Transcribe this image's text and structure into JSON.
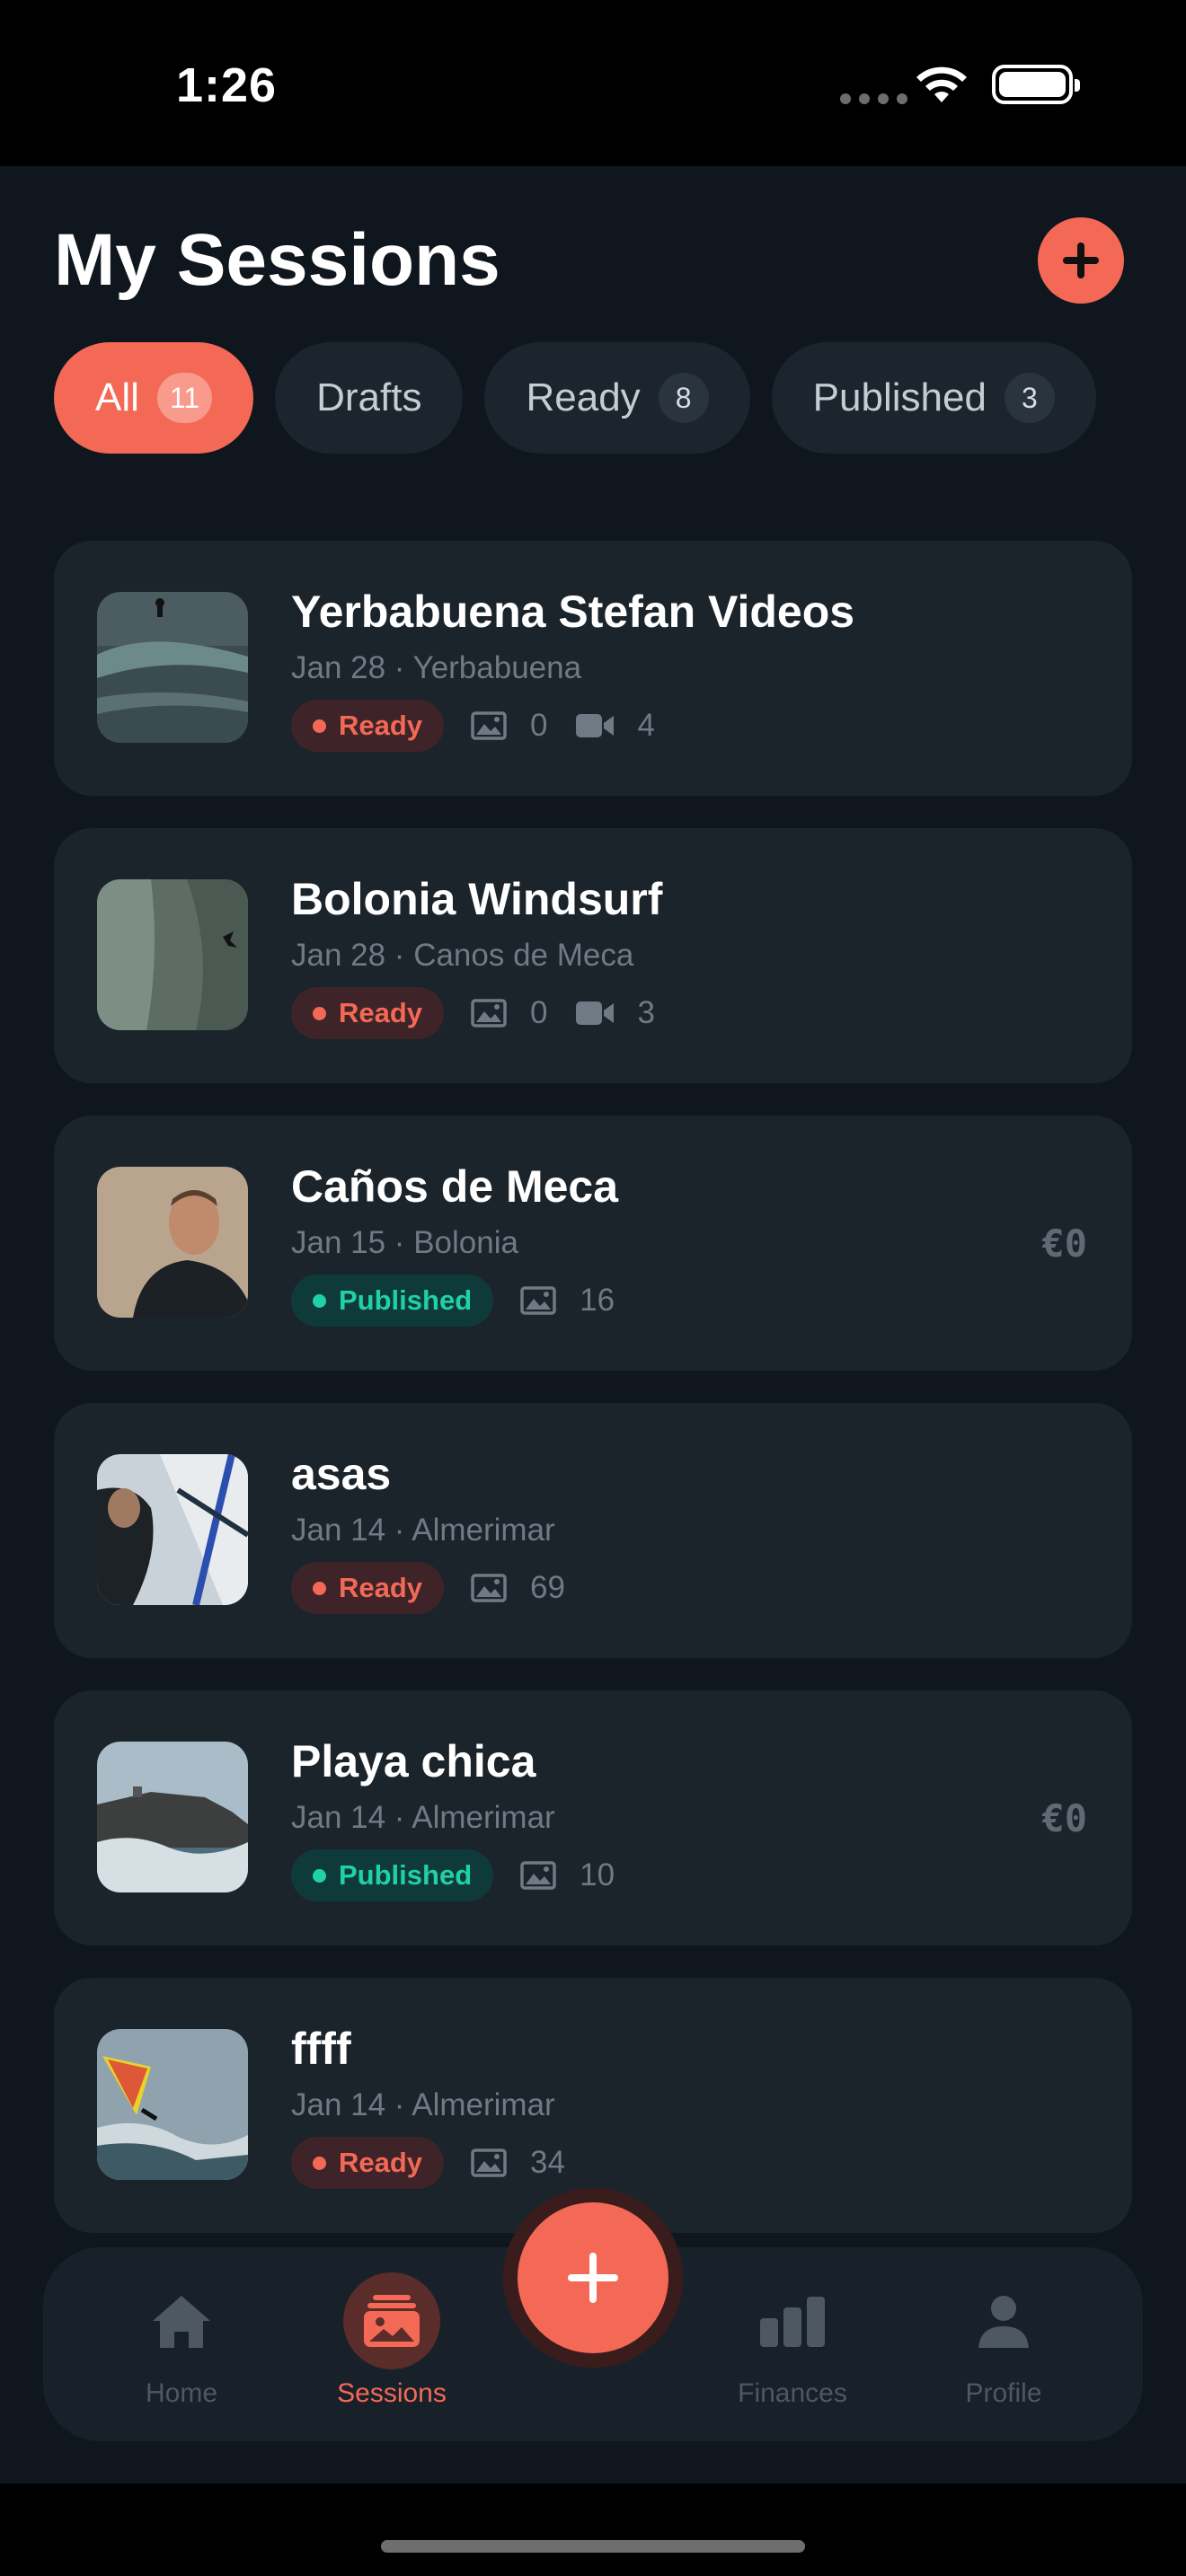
{
  "status": {
    "time": "1:26"
  },
  "header": {
    "title": "My Sessions"
  },
  "filters": [
    {
      "label": "All",
      "count": "11",
      "active": true
    },
    {
      "label": "Drafts",
      "count": ""
    },
    {
      "label": "Ready",
      "count": "8"
    },
    {
      "label": "Published",
      "count": "3"
    }
  ],
  "sessions": [
    {
      "title": "Yerbabuena Stefan Videos",
      "meta": "Jan 28 · Yerbabuena",
      "status": "Ready",
      "photos": "0",
      "videos": "4",
      "price": "",
      "thumb_icon": "surf-wave-photo"
    },
    {
      "title": "Bolonia Windsurf",
      "meta": "Jan 28 · Canos de Meca",
      "status": "Ready",
      "photos": "0",
      "videos": "3",
      "price": "",
      "thumb_icon": "water-photo"
    },
    {
      "title": "Caños de Meca",
      "meta": "Jan 15 · Bolonia",
      "status": "Published",
      "photos": "16",
      "videos": "",
      "price": "€0",
      "thumb_icon": "portrait-photo"
    },
    {
      "title": "asas",
      "meta": "Jan 14 · Almerimar",
      "status": "Ready",
      "photos": "69",
      "videos": "",
      "price": "",
      "thumb_icon": "windsurfer-photo"
    },
    {
      "title": "Playa chica",
      "meta": "Jan 14 · Almerimar",
      "status": "Published",
      "photos": "10",
      "videos": "",
      "price": "€0",
      "thumb_icon": "rock-sea-photo"
    },
    {
      "title": "ffff",
      "meta": "Jan 14 · Almerimar",
      "status": "Ready",
      "photos": "34",
      "videos": "",
      "price": "",
      "thumb_icon": "windsurf-jump-photo"
    }
  ],
  "tabbar": {
    "home": "Home",
    "sessions": "Sessions",
    "finances": "Finances",
    "profile": "Profile"
  },
  "colors": {
    "accent": "#f46856",
    "published": "#20d0a8",
    "background": "#0f161d",
    "card": "#1b232b"
  }
}
